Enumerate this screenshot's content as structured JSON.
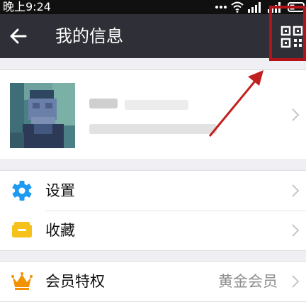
{
  "status_bar": {
    "time": "晚上9:24",
    "icons": [
      "more-dots-icon",
      "wifi-icon",
      "signal-icon",
      "signal-icon",
      "battery-icon"
    ]
  },
  "nav": {
    "title": "我的信息",
    "back_icon": "arrow-left-icon",
    "qr_icon": "qr-code-icon"
  },
  "profile": {
    "avatar_icon": "avatar-pixelated"
  },
  "menu": {
    "group1": [
      {
        "label": "设置",
        "icon": "gear-icon",
        "color": "#1e9bf0"
      },
      {
        "label": "收藏",
        "icon": "folder-icon",
        "color": "#f5c21b"
      }
    ],
    "group2": [
      {
        "label": "会员特权",
        "value": "黄金会员",
        "icon": "crown-icon",
        "color": "#f39200"
      }
    ]
  },
  "colors": {
    "nav_background": "#2f2f37",
    "highlight": "#b11418",
    "page_background": "#efeff4"
  }
}
